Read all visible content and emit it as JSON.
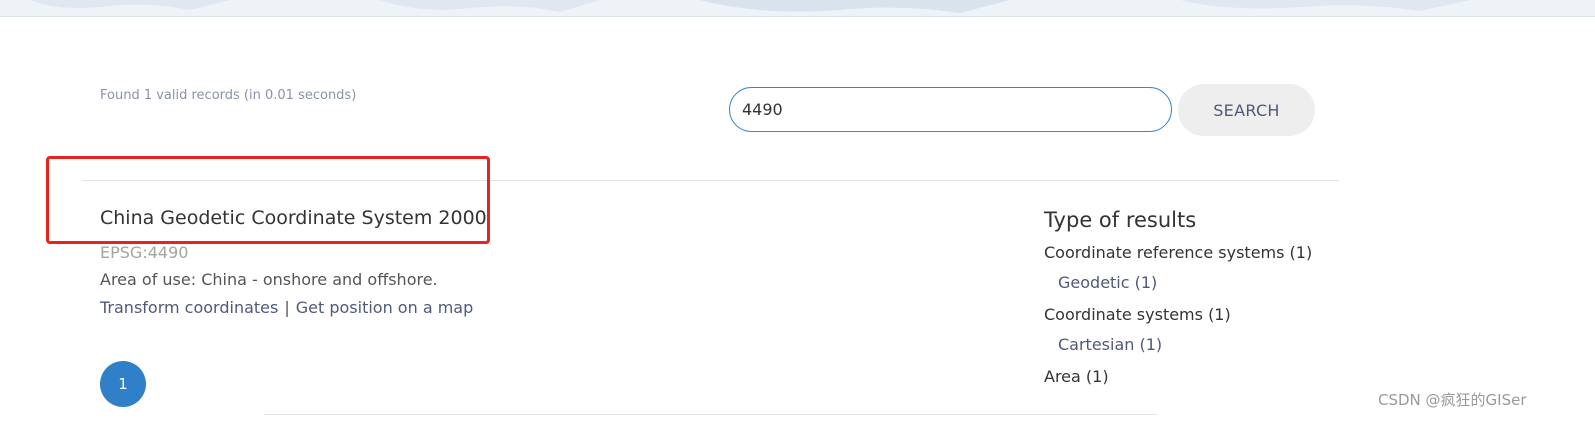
{
  "results": {
    "found_text": "Found 1 valid records (in 0.01 seconds)",
    "item": {
      "title": "China Geodetic Coordinate System 2000",
      "code": "EPSG:4490",
      "area": "Area of use: China - onshore and offshore.",
      "transform_link": "Transform coordinates",
      "separator": "|",
      "map_link": "Get position on a map"
    }
  },
  "search": {
    "value": "4490",
    "button_label": "SEARCH"
  },
  "pagination": {
    "current_page": "1"
  },
  "facets": {
    "title": "Type of results",
    "crs": "Coordinate reference systems (1)",
    "crs_geodetic": "Geodetic (1)",
    "cs": "Coordinate systems (1)",
    "cs_cartesian": "Cartesian (1)",
    "area": "Area (1)"
  },
  "watermark": "CSDN @疯狂的GISer",
  "colors": {
    "accent": "#2f80c8",
    "highlight": "#e8231f",
    "link": "#4f5a7a"
  }
}
